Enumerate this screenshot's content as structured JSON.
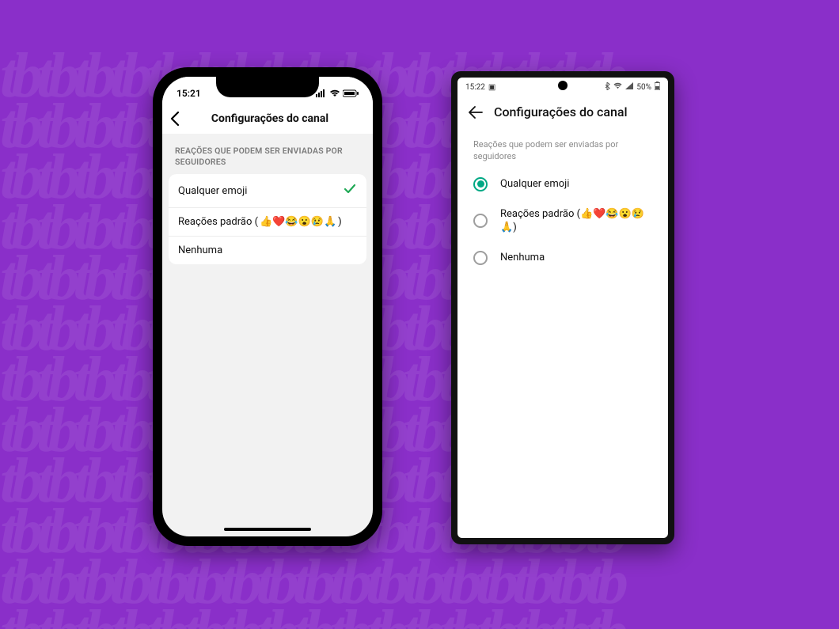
{
  "background": {
    "color": "#8a2fc9",
    "pattern_text": "tb"
  },
  "ios": {
    "statusbar": {
      "time": "15:21"
    },
    "header": {
      "title": "Configurações do canal"
    },
    "section_label": "REAÇÕES QUE PODEM SER ENVIADAS POR SEGUIDORES",
    "options": [
      {
        "label": "Qualquer emoji",
        "emojis": "",
        "selected": true
      },
      {
        "label": "Reações padrão (",
        "emojis": "👍❤️😂😮😢🙏",
        "label_after": ")",
        "selected": false
      },
      {
        "label": "Nenhuma",
        "emojis": "",
        "selected": false
      }
    ]
  },
  "android": {
    "statusbar": {
      "time": "15:22",
      "battery": "50%"
    },
    "header": {
      "title": "Configurações do canal"
    },
    "section_label": "Reações que podem ser enviadas por seguidores",
    "options": [
      {
        "label": "Qualquer emoji",
        "emojis": "",
        "selected": true
      },
      {
        "label": "Reações padrão (",
        "emojis": "👍❤️😂😮😢🙏",
        "label_after": ")",
        "selected": false
      },
      {
        "label": "Nenhuma",
        "emojis": "",
        "selected": false
      }
    ]
  }
}
